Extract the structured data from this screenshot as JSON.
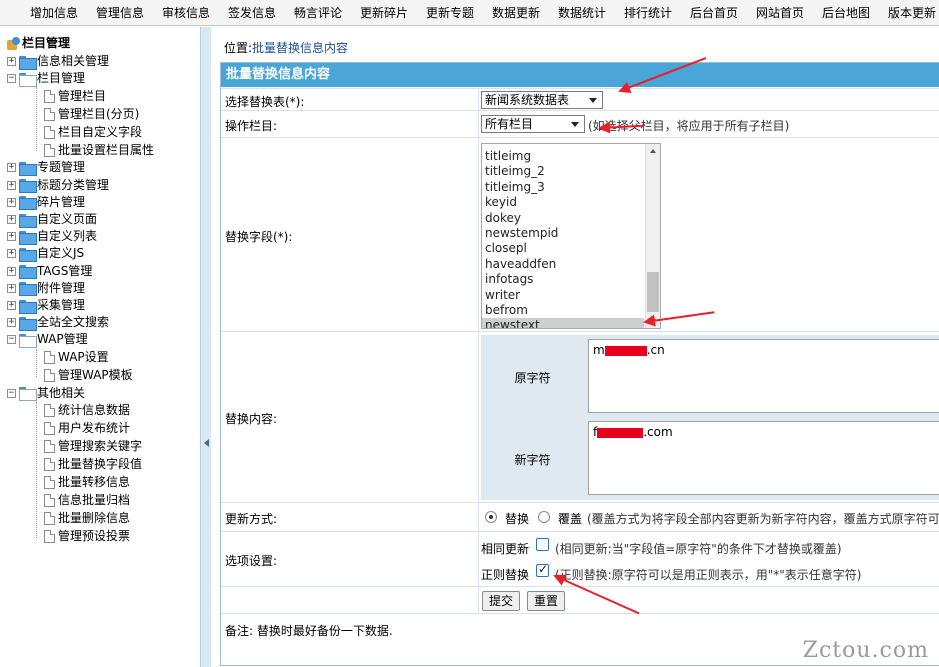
{
  "topnav": [
    "增加信息",
    "管理信息",
    "审核信息",
    "签发信息",
    "畅言评论",
    "更新碎片",
    "更新专题",
    "数据更新",
    "数据统计",
    "排行统计",
    "后台首页",
    "网站首页",
    "后台地图",
    "版本更新"
  ],
  "tree": {
    "root": "栏目管理",
    "nodes": [
      {
        "label": "信息相关管理",
        "expanded": false
      },
      {
        "label": "栏目管理",
        "expanded": true,
        "children": [
          "管理栏目",
          "管理栏目(分页)",
          "栏目自定义字段",
          "批量设置栏目属性"
        ]
      },
      {
        "label": "专题管理",
        "expanded": false
      },
      {
        "label": "标题分类管理",
        "expanded": false
      },
      {
        "label": "碎片管理",
        "expanded": false
      },
      {
        "label": "自定义页面",
        "expanded": false
      },
      {
        "label": "自定义列表",
        "expanded": false
      },
      {
        "label": "自定义JS",
        "expanded": false
      },
      {
        "label": "TAGS管理",
        "expanded": false
      },
      {
        "label": "附件管理",
        "expanded": false
      },
      {
        "label": "采集管理",
        "expanded": false
      },
      {
        "label": "全站全文搜索",
        "expanded": false
      },
      {
        "label": "WAP管理",
        "expanded": true,
        "children": [
          "WAP设置",
          "管理WAP模板"
        ]
      },
      {
        "label": "其他相关",
        "expanded": true,
        "children": [
          "统计信息数据",
          "用户发布统计",
          "管理搜索关键字",
          "批量替换字段值",
          "批量转移信息",
          "信息批量归档",
          "批量删除信息",
          "管理预设投票"
        ]
      }
    ]
  },
  "breadcrumb": {
    "prefix": "位置:",
    "link": "批量替换信息内容"
  },
  "form": {
    "title": "批量替换信息内容",
    "table_label": "选择替换表(*):",
    "table_value": "新闻系统数据表",
    "column_label": "操作栏目:",
    "column_value": "所有栏目",
    "column_hint": "(如选择父栏目，将应用于所有子栏目)",
    "field_label": "替换字段(*):",
    "fields": [
      "titleimg",
      "titleimg_2",
      "titleimg_3",
      "keyid",
      "dokey",
      "newstempid",
      "closepl",
      "haveaddfen",
      "infotags",
      "writer",
      "befrom",
      "newstext"
    ],
    "selected_field": "newstext",
    "content_label": "替换内容:",
    "old_label": "原字符",
    "old_prefix": "m",
    "old_suffix": ".cn",
    "new_label": "新字符",
    "new_prefix": "f",
    "new_suffix": ".com",
    "mode_label": "更新方式:",
    "mode_replace": "替换",
    "mode_cover": "覆盖",
    "mode_hint": "(覆盖方式为将字段全部内容更新为新字符内容，覆盖方式原字符可",
    "options_label": "选项设置:",
    "same_update": "相同更新",
    "same_update_hint": "(相同更新:当\"字段值=原字符\"的条件下才替换或覆盖)",
    "regex": "正则替换",
    "regex_hint": "(正则替换:原字符可以是用正则表示，用\"*\"表示任意字符)",
    "submit": "提交",
    "reset": "重置",
    "note": "备注: 替换时最好备份一下数据."
  },
  "watermark": "Zctou.com",
  "colors": {
    "header": "#4aa6d8",
    "annotation_arrow": "#e8202a",
    "redaction": "#e8001f"
  }
}
